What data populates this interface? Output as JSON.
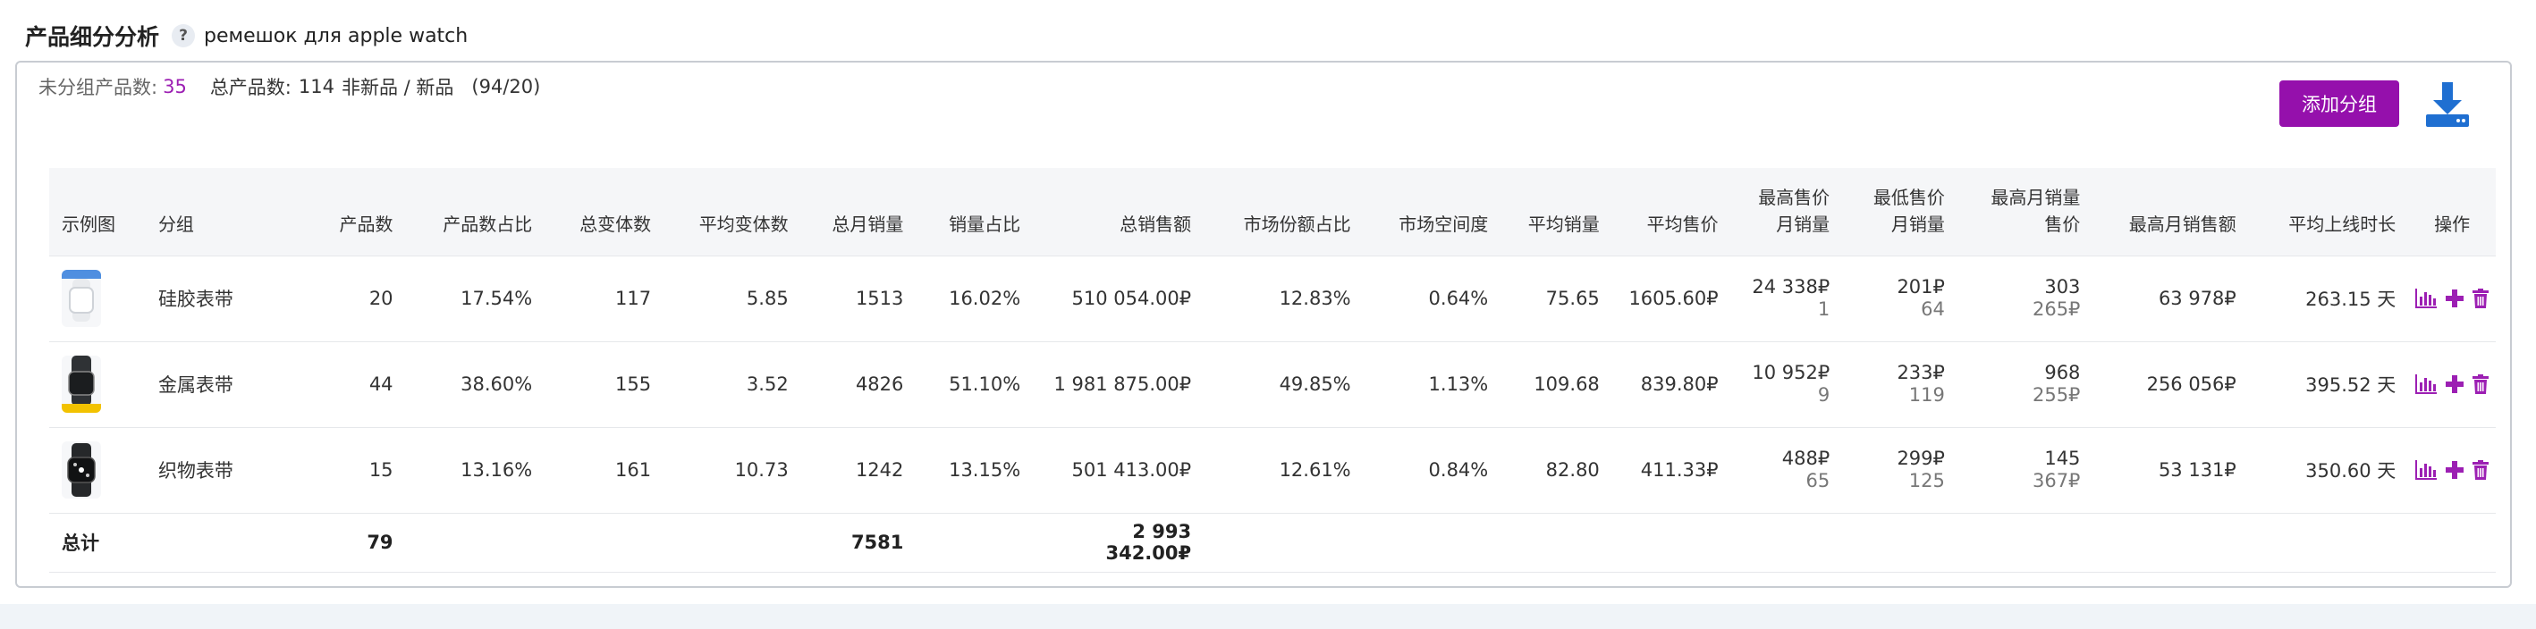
{
  "header": {
    "title": "产品细分分析",
    "help_glyph": "?",
    "keyword": "ремешок для apple watch"
  },
  "stats": {
    "ungrouped_label": "未分组产品数:",
    "ungrouped_value": "35",
    "total_label": "总产品数:",
    "total_value": "114",
    "new_label": "非新品 / 新品",
    "new_value": "(94/20)"
  },
  "actions": {
    "add_group_label": "添加分组"
  },
  "columns": {
    "image": "示例图",
    "group": "分组",
    "products": "产品数",
    "products_share": "产品数占比",
    "variants_total": "总变体数",
    "variants_avg": "平均变体数",
    "monthly_sales": "总月销量",
    "sales_share": "销量占比",
    "revenue": "总销售额",
    "market_share": "市场份额占比",
    "market_space": "市场空间度",
    "avg_sales": "平均销量",
    "avg_price": "平均售价",
    "max_price_l1": "最高售价",
    "max_price_l2": "月销量",
    "min_price_l1": "最低售价",
    "min_price_l2": "月销量",
    "max_sales_l1": "最高月销量",
    "max_sales_l2": "售价",
    "max_revenue": "最高月销售额",
    "avg_listing": "平均上线时长",
    "ops": "操作"
  },
  "rows": [
    {
      "group": "硅胶表带",
      "products": "20",
      "products_share": "17.54%",
      "variants_total": "117",
      "variants_avg": "5.85",
      "monthly_sales": "1513",
      "sales_share": "16.02%",
      "revenue": "510 054.00₽",
      "market_share": "12.83%",
      "market_space": "0.64%",
      "avg_sales": "75.65",
      "avg_price": "1605.60₽",
      "max_price": "24 338₽",
      "max_price_sales": "1",
      "min_price": "201₽",
      "min_price_sales": "64",
      "max_sales": "303",
      "max_sales_price": "265₽",
      "max_revenue": "63 978₽",
      "avg_listing": "263.15 天"
    },
    {
      "group": "金属表带",
      "products": "44",
      "products_share": "38.60%",
      "variants_total": "155",
      "variants_avg": "3.52",
      "monthly_sales": "4826",
      "sales_share": "51.10%",
      "revenue": "1 981 875.00₽",
      "market_share": "49.85%",
      "market_space": "1.13%",
      "avg_sales": "109.68",
      "avg_price": "839.80₽",
      "max_price": "10 952₽",
      "max_price_sales": "9",
      "min_price": "233₽",
      "min_price_sales": "119",
      "max_sales": "968",
      "max_sales_price": "255₽",
      "max_revenue": "256 056₽",
      "avg_listing": "395.52 天"
    },
    {
      "group": "织物表带",
      "products": "15",
      "products_share": "13.16%",
      "variants_total": "161",
      "variants_avg": "10.73",
      "monthly_sales": "1242",
      "sales_share": "13.15%",
      "revenue": "501 413.00₽",
      "market_share": "12.61%",
      "market_space": "0.84%",
      "avg_sales": "82.80",
      "avg_price": "411.33₽",
      "max_price": "488₽",
      "max_price_sales": "65",
      "min_price": "299₽",
      "min_price_sales": "125",
      "max_sales": "145",
      "max_sales_price": "367₽",
      "max_revenue": "53 131₽",
      "avg_listing": "350.60 天"
    }
  ],
  "total": {
    "label": "总计",
    "products": "79",
    "monthly_sales": "7581",
    "revenue": "2 993 342.00₽"
  },
  "colors": {
    "accent": "#9510ac",
    "accent_text": "#9c1fb3",
    "download_icon": "#1f6fd1"
  },
  "icons": {
    "help": "question-icon",
    "download": "download-icon",
    "chart": "bar-chart-icon",
    "add": "plus-icon",
    "delete": "trash-icon"
  }
}
